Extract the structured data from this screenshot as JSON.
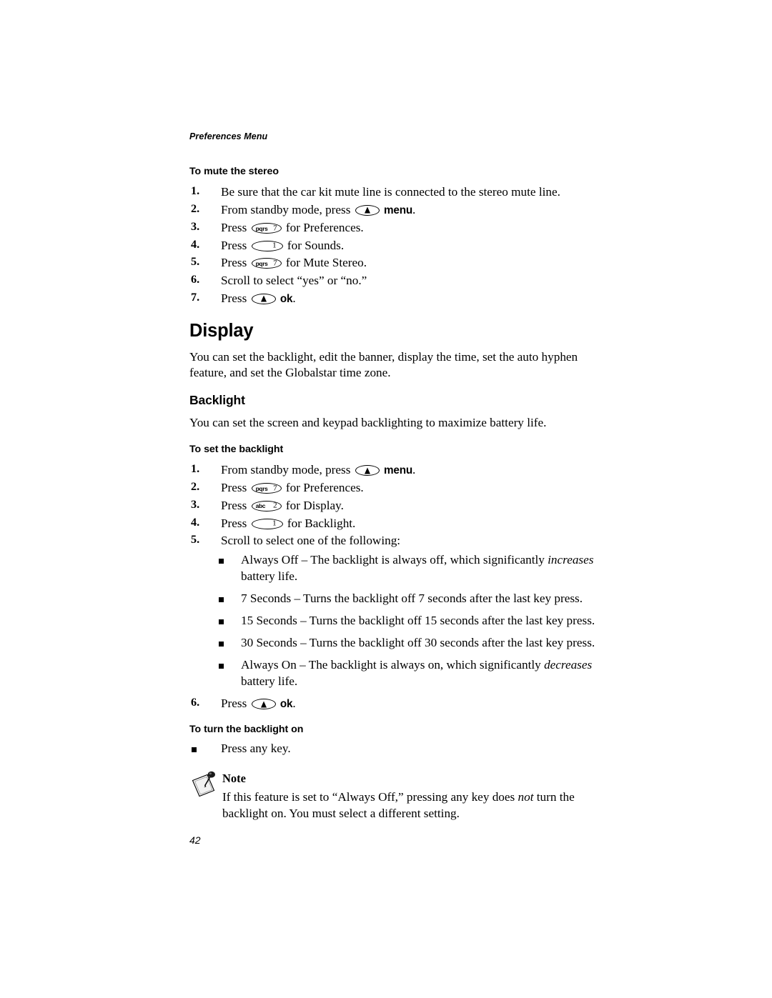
{
  "header": {
    "running_head": "Preferences Menu"
  },
  "page_number": "42",
  "keys": {
    "softkey_glyph": "up-triangle",
    "menu_label": "menu",
    "ok_label": "ok",
    "key_7_letters": "pqrs",
    "key_7_digit": "7",
    "key_2_letters": "abc",
    "key_2_digit": "2",
    "key_1_digit": "1"
  },
  "sections": {
    "mute_stereo": {
      "heading": "To mute the stereo",
      "steps": {
        "s1_num": "1.",
        "s1_text": "Be sure that the car kit mute line is connected to the stereo mute line.",
        "s2_num": "2.",
        "s2_pre": "From standby mode, press",
        "s2_post": ".",
        "s3_num": "3.",
        "s3_pre": "Press",
        "s3_post": "for Preferences.",
        "s4_num": "4.",
        "s4_pre": "Press",
        "s4_post": "for Sounds.",
        "s5_num": "5.",
        "s5_pre": "Press",
        "s5_post": "for Mute Stereo.",
        "s6_num": "6.",
        "s6_text": "Scroll to select “yes” or “no.”",
        "s7_num": "7.",
        "s7_pre": "Press",
        "s7_post": "."
      }
    },
    "display": {
      "heading": "Display",
      "intro": "You can set the backlight, edit the banner, display the time, set the auto hyphen feature, and set the Globalstar time zone."
    },
    "backlight": {
      "heading": "Backlight",
      "intro": "You can set the screen and keypad backlighting to maximize battery life.",
      "set_heading": "To set the backlight",
      "steps": {
        "s1_num": "1.",
        "s1_pre": "From standby mode, press",
        "s1_post": ".",
        "s2_num": "2.",
        "s2_pre": "Press",
        "s2_post": "for Preferences.",
        "s3_num": "3.",
        "s3_pre": "Press",
        "s3_post": "for Display.",
        "s4_num": "4.",
        "s4_pre": "Press",
        "s4_post": "for Backlight.",
        "s5_num": "5.",
        "s5_text": "Scroll to select one of the following:",
        "s6_num": "6.",
        "s6_pre": "Press",
        "s6_post": "."
      },
      "options": [
        {
          "lead": "Always Off – The backlight is always off, which significantly ",
          "emphasis": "increases",
          "tail": " battery life."
        },
        {
          "lead": "7 Seconds – Turns the backlight off 7 seconds after the last key press.",
          "emphasis": "",
          "tail": ""
        },
        {
          "lead": "15 Seconds – Turns the backlight off 15 seconds after the last key press.",
          "emphasis": "",
          "tail": ""
        },
        {
          "lead": "30 Seconds – Turns the backlight off 30 seconds after the last key press.",
          "emphasis": "",
          "tail": ""
        },
        {
          "lead": "Always On – The backlight is always on, which significantly ",
          "emphasis": "decreases",
          "tail": " battery life."
        }
      ],
      "turn_on_heading": "To turn the backlight on",
      "turn_on_bullet": "Press any key."
    },
    "note": {
      "title": "Note",
      "body_pre": "If this feature is set to “Always Off,” pressing any key does ",
      "body_em": "not",
      "body_post": " turn the backlight on. You must select a different setting."
    }
  }
}
